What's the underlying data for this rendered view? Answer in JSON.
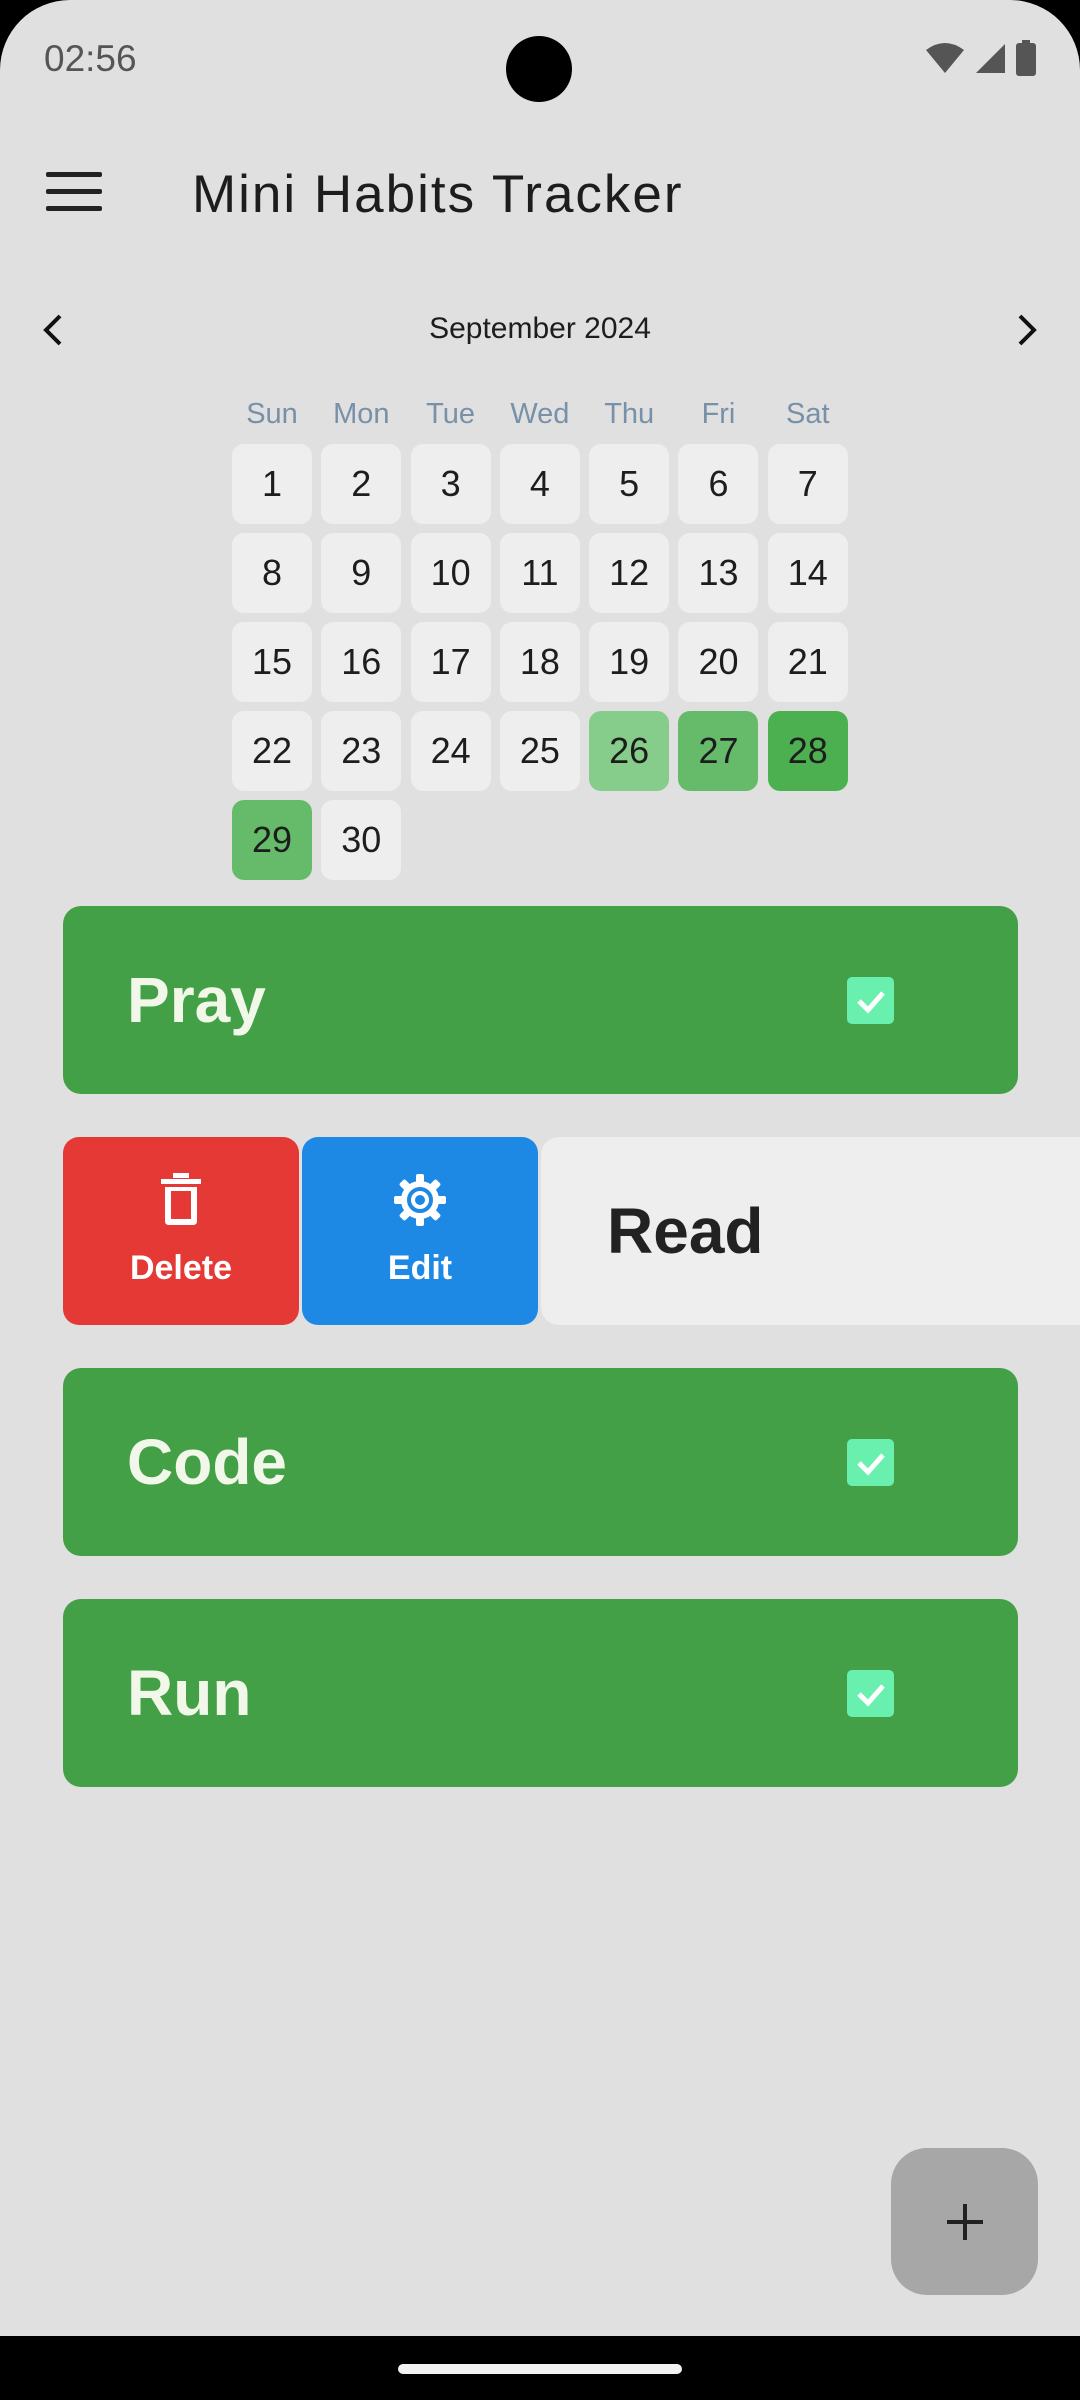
{
  "status": {
    "time": "02:56"
  },
  "app": {
    "title": "Mini Habits Tracker"
  },
  "calendar": {
    "month": "September 2024",
    "weekdays": [
      "Sun",
      "Mon",
      "Tue",
      "Wed",
      "Thu",
      "Fri",
      "Sat"
    ],
    "days": [
      "1",
      "2",
      "3",
      "4",
      "5",
      "6",
      "7",
      "8",
      "9",
      "10",
      "11",
      "12",
      "13",
      "14",
      "15",
      "16",
      "17",
      "18",
      "19",
      "20",
      "21",
      "22",
      "23",
      "24",
      "25",
      "26",
      "27",
      "28",
      "29",
      "30"
    ],
    "highlight_colors": {
      "26": "#86cc8a",
      "27": "#66bb6a",
      "28": "#4caf50",
      "29": "#66bb6a"
    }
  },
  "habits": [
    {
      "name": "Pray",
      "completed": true
    },
    {
      "name": "Read",
      "completed": false
    },
    {
      "name": "Code",
      "completed": true
    },
    {
      "name": "Run",
      "completed": true
    }
  ],
  "swipe_actions": {
    "delete_label": "Delete",
    "edit_label": "Edit"
  },
  "colors": {
    "habit_done": "#43a047",
    "delete": "#e53935",
    "edit": "#1e88e5",
    "checkbox": "#69f0ae"
  },
  "icons": {
    "menu": "hamburger-menu-icon",
    "prev": "chevron-left-icon",
    "next": "chevron-right-icon",
    "delete": "trash-icon",
    "edit": "gear-icon",
    "check": "check-icon",
    "fab": "plus-icon"
  }
}
